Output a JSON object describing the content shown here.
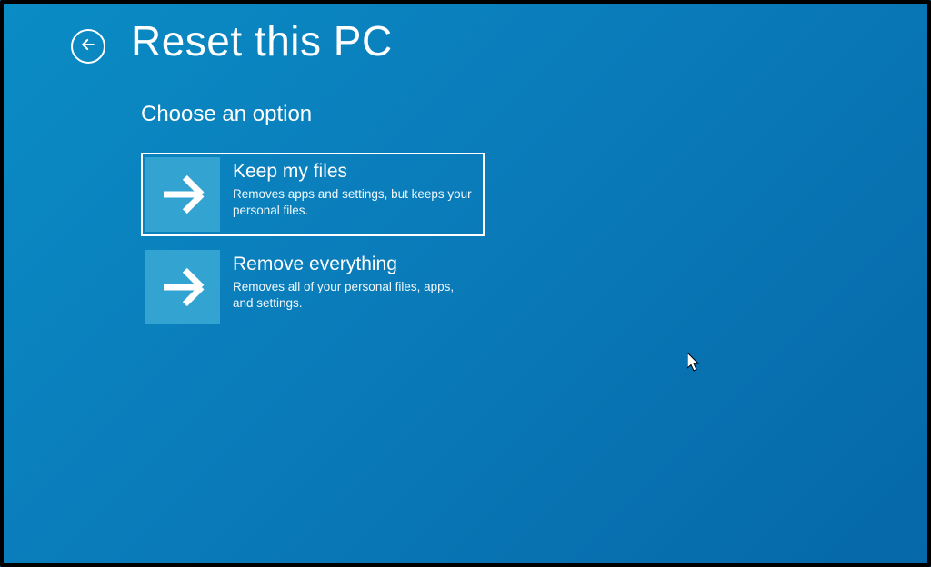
{
  "header": {
    "title": "Reset this PC"
  },
  "content": {
    "subtitle": "Choose an option",
    "options": [
      {
        "title": "Keep my files",
        "description": "Removes apps and settings, but keeps your personal files.",
        "selected": true
      },
      {
        "title": "Remove everything",
        "description": "Removes all of your personal files, apps, and settings.",
        "selected": false
      }
    ]
  }
}
